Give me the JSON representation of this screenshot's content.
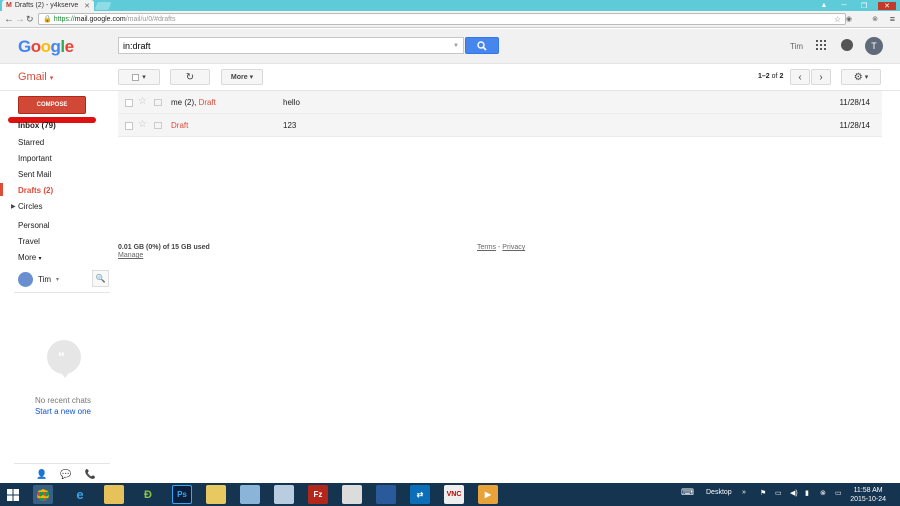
{
  "browser": {
    "tab_title": "Drafts (2) - y4kserve",
    "url_scheme": "https://",
    "url_domain": "mail.google.com",
    "url_path": "/mail/u/0/#drafts"
  },
  "header": {
    "logo": "Google",
    "search_value": "in:draft",
    "user_name": "Tim",
    "avatar_letter": "T"
  },
  "toolbar": {
    "app_label": "Gmail",
    "more_label": "More",
    "count_range": "1–2",
    "count_of": "of",
    "count_total": "2"
  },
  "nav": {
    "compose": "COMPOSE",
    "items": [
      "Inbox (79)",
      "Starred",
      "Important",
      "Sent Mail",
      "Drafts (2)",
      "Circles",
      "Personal",
      "Travel",
      "More"
    ]
  },
  "hangouts": {
    "user": "Tim",
    "no_chats": "No recent chats",
    "start_new": "Start a new one"
  },
  "mails": [
    {
      "sender": "me (2), ",
      "draft": "Draft",
      "subject": "hello",
      "date": "11/28/14"
    },
    {
      "sender": "",
      "draft": "Draft",
      "subject": "123",
      "date": "11/28/14"
    }
  ],
  "footer": {
    "storage_bold": "0.01 GB (0%) of 15 GB used",
    "manage": "Manage",
    "terms": "Terms",
    "sep": " - ",
    "privacy": "Privacy"
  },
  "taskbar": {
    "desktop_label": "Desktop",
    "time": "11:58 AM",
    "date": "2015-10-24"
  },
  "colors": {
    "brand_red": "#dd4b39",
    "compose_red": "#d14836",
    "search_blue": "#4787ed",
    "taskbar": "#15344f"
  }
}
